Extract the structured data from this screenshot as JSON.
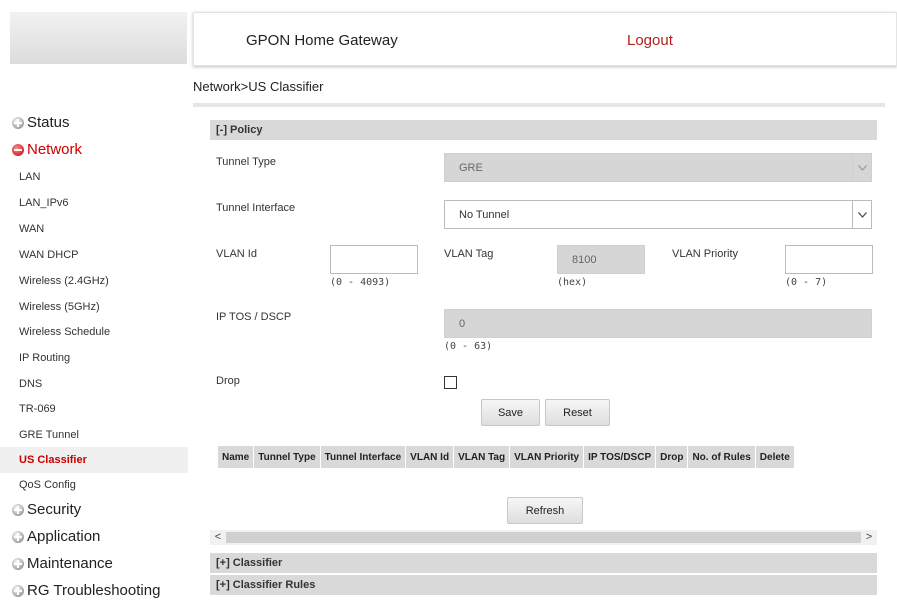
{
  "header": {
    "title": "GPON Home Gateway",
    "logout": "Logout"
  },
  "breadcrumb": "Network>US Classifier",
  "sidebar": {
    "groups": [
      {
        "label": "Status",
        "state": "collapsed"
      },
      {
        "label": "Network",
        "state": "expanded"
      },
      {
        "label": "Security",
        "state": "collapsed"
      },
      {
        "label": "Application",
        "state": "collapsed"
      },
      {
        "label": "Maintenance",
        "state": "collapsed"
      },
      {
        "label": "RG Troubleshooting",
        "state": "collapsed"
      }
    ],
    "network_items": [
      "LAN",
      "LAN_IPv6",
      "WAN",
      "WAN DHCP",
      "Wireless (2.4GHz)",
      "Wireless (5GHz)",
      "Wireless Schedule",
      "IP Routing",
      "DNS",
      "TR-069",
      "GRE Tunnel",
      "US Classifier",
      "QoS Config"
    ],
    "active_item": "US Classifier"
  },
  "policy": {
    "header": "[-] Policy",
    "tunnel_type": {
      "label": "Tunnel Type",
      "value": "GRE"
    },
    "tunnel_interface": {
      "label": "Tunnel Interface",
      "value": "No Tunnel"
    },
    "vlan_id": {
      "label": "VLAN Id",
      "value": "",
      "hint": "(0 - 4093)"
    },
    "vlan_tag": {
      "label": "VLAN Tag",
      "value": "8100",
      "hint": "(hex)"
    },
    "vlan_priority": {
      "label": "VLAN Priority",
      "value": "",
      "hint": "(0 - 7)"
    },
    "ip_tos": {
      "label": "IP TOS / DSCP",
      "value": "0",
      "hint": "(0 - 63)"
    },
    "drop": {
      "label": "Drop",
      "checked": false
    },
    "save": "Save",
    "reset": "Reset",
    "table_headers": [
      "Name",
      "Tunnel Type",
      "Tunnel Interface",
      "VLAN Id",
      "VLAN Tag",
      "VLAN Priority",
      "IP TOS/DSCP",
      "Drop",
      "No. of Rules",
      "Delete"
    ],
    "refresh": "Refresh"
  },
  "classifier_header": "[+] Classifier",
  "classifier_rules_header": "[+] Classifier Rules",
  "scroll_arrows": {
    "left": "<",
    "right": ">"
  },
  "icons": {
    "collapsed": "plus-circle-icon",
    "expanded": "minus-circle-icon",
    "select": "chevron-down-icon"
  },
  "colors": {
    "logout": "#b21f1f",
    "active_nav": "#cc0000",
    "section_bg": "#d9d9d9"
  }
}
